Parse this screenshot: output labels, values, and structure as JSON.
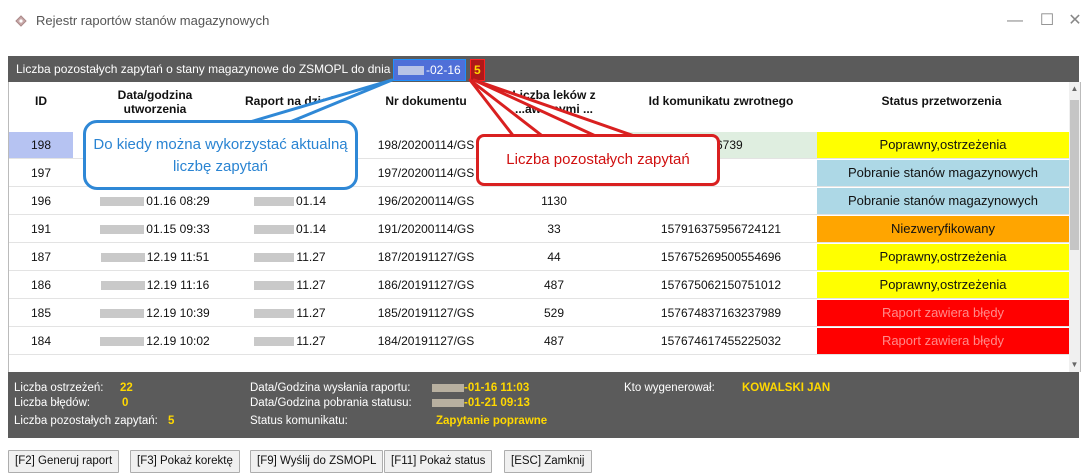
{
  "window": {
    "title": "Rejestr raportów stanów magazynowych",
    "minimize": "—",
    "maximize": "☐",
    "close": "✕"
  },
  "infobar": {
    "label": "Liczba pozostałych zapytań o stany magazynowe do ZSMOPL do dnia :",
    "date_suffix": "-02-16",
    "remaining": "5"
  },
  "columns": [
    "ID",
    "Data/godzina utworzenia",
    "Raport na dzień",
    "Nr dokumentu",
    "Liczba leków z ...awionymi ...",
    "Id komunikatu zwrotnego",
    "Status przetworzenia"
  ],
  "rows": [
    {
      "id": "198",
      "created": "",
      "report_day": "",
      "doc": "198/20200114/GS",
      "count": "",
      "msg_id": "...26739",
      "status": "Poprawny,ostrzeżenia",
      "status_color": "#ffff00",
      "status_text": "#111111"
    },
    {
      "id": "197",
      "created": "",
      "report_day": "",
      "doc": "197/20200114/GS",
      "count": "",
      "msg_id": "",
      "status": "Pobranie stanów magazynowych",
      "status_color": "#add8e6",
      "status_text": "#111111"
    },
    {
      "id": "196",
      "created": "01.16 08:29",
      "report_day": "01.14",
      "doc": "196/20200114/GS",
      "count": "1130",
      "msg_id": "",
      "status": "Pobranie stanów magazynowych",
      "status_color": "#add8e6",
      "status_text": "#111111"
    },
    {
      "id": "191",
      "created": "01.15 09:33",
      "report_day": "01.14",
      "doc": "191/20200114/GS",
      "count": "33",
      "msg_id": "157916375956724121",
      "status": "Niezweryfikowany",
      "status_color": "#ffa500",
      "status_text": "#111111"
    },
    {
      "id": "187",
      "created": "12.19 11:51",
      "report_day": "11.27",
      "doc": "187/20191127/GS",
      "count": "44",
      "msg_id": "157675269500554696",
      "status": "Poprawny,ostrzeżenia",
      "status_color": "#ffff00",
      "status_text": "#111111"
    },
    {
      "id": "186",
      "created": "12.19 11:16",
      "report_day": "11.27",
      "doc": "186/20191127/GS",
      "count": "487",
      "msg_id": "157675062150751012",
      "status": "Poprawny,ostrzeżenia",
      "status_color": "#ffff00",
      "status_text": "#111111"
    },
    {
      "id": "185",
      "created": "12.19 10:39",
      "report_day": "11.27",
      "doc": "185/20191127/GS",
      "count": "529",
      "msg_id": "157674837163237989",
      "status": "Raport zawiera błędy",
      "status_color": "#ff0000",
      "status_text": "#ff8a8a"
    },
    {
      "id": "184",
      "created": "12.19 10:02",
      "report_day": "11.27",
      "doc": "184/20191127/GS",
      "count": "487",
      "msg_id": "157674617455225032",
      "status": "Raport zawiera błędy",
      "status_color": "#ff0000",
      "status_text": "#ff8a8a"
    }
  ],
  "footer": {
    "warnings_label": "Liczba ostrzeżeń:",
    "warnings": "22",
    "errors_label": "Liczba błędów:",
    "errors": "0",
    "remaining_label": "Liczba pozostałych zapytań:",
    "remaining": "5",
    "sent_label": "Data/Godzina wysłania raportu:",
    "sent": "-01-16 11:03",
    "fetched_label": "Data/Godzina pobrania statusu:",
    "fetched": "-01-21 09:13",
    "msg_status_label": "Status komunikatu:",
    "msg_status": "Zapytanie poprawne",
    "generated_by_label": "Kto wygenerował:",
    "generated_by": "KOWALSKI JAN"
  },
  "buttons": {
    "generate": "[F2] Generuj raport",
    "correction": "[F3] Pokaż korektę",
    "send": "[F9] Wyślij do ZSMOPL",
    "status": "[F11] Pokaż status",
    "close": "[ESC] Zamknij"
  },
  "callouts": {
    "blue": "Do kiedy można wykorzystać aktualną liczbę zapytań",
    "red": "Liczba pozostałych zapytań"
  },
  "colors": {
    "infobar": "#5b5b5b",
    "highlight_blue": "#2f88d6",
    "highlight_red": "#d92020"
  }
}
